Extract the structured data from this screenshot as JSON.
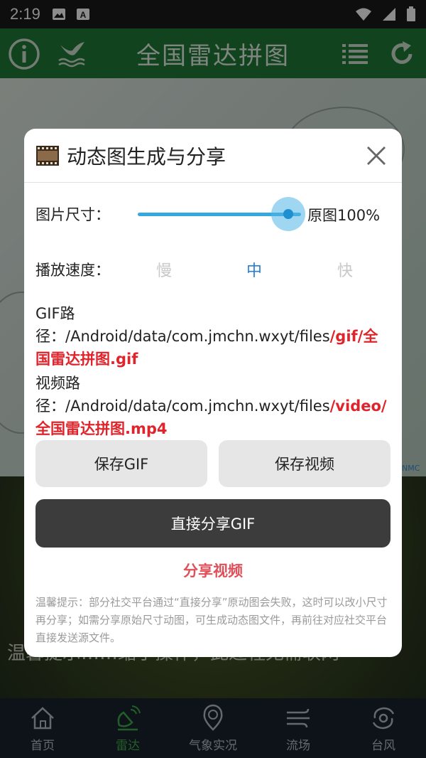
{
  "status_bar": {
    "time": "2:19"
  },
  "app_header": {
    "title": "全国雷达拼图",
    "info_icon": "info-icon",
    "logo_icon": "bird-wave-logo-icon",
    "list_icon": "list-icon",
    "refresh_icon": "refresh-icon"
  },
  "background": {
    "nmc_label": "NMC",
    "caption": "温馨提示……缩小操作，此过程无需联网"
  },
  "dialog": {
    "title": "动态图生成与分享",
    "size": {
      "label": "图片尺寸：",
      "value_text": "原图100%",
      "level": 1.0
    },
    "speed": {
      "label": "播放速度：",
      "options": [
        "慢",
        "中",
        "快"
      ],
      "selected": "中"
    },
    "gif_path": {
      "label": "GIF路径：",
      "prefix": "/Android/data/com.jmchn.wxyt/files",
      "highlight": "/gif/全国雷达拼图.gif"
    },
    "video_path": {
      "label": "视频路径：",
      "prefix": "/Android/data/com.jmchn.wxyt/files",
      "highlight": "/video/全国雷达拼图.mp4"
    },
    "buttons": {
      "save_gif": "保存GIF",
      "save_video": "保存视频",
      "share_gif": "直接分享GIF",
      "share_video": "分享视频"
    },
    "tip": "温馨提示：部分社交平台通过“直接分享”原动图会失败，这时可以改小尺寸再分享；如需分享原始尺寸动图，可生成动态图文件，再前往对应社交平台直接发送源文件。"
  },
  "bottom_nav": {
    "items": [
      {
        "label": "首页",
        "icon": "home-icon"
      },
      {
        "label": "雷达",
        "icon": "radar-icon",
        "active": true
      },
      {
        "label": "气象实况",
        "icon": "weather-live-icon"
      },
      {
        "label": "流场",
        "icon": "wind-flow-icon"
      },
      {
        "label": "台风",
        "icon": "typhoon-icon"
      }
    ]
  },
  "colors": {
    "accent": "#1e8fcf",
    "highlight_red": "#e0242c",
    "nav_active": "#3fae49"
  }
}
